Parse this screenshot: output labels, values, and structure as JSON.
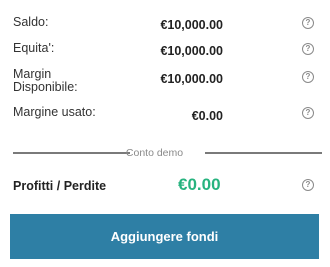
{
  "account": {
    "rows": [
      {
        "label": "Saldo:",
        "value": "€10,000.00"
      },
      {
        "label": "Equita':",
        "value": "€10,000.00"
      },
      {
        "label": "Margin\nDisponibile:",
        "value": "€10,000.00"
      },
      {
        "label": "Margine usato:",
        "value": "€0.00"
      }
    ],
    "help_icon": "?"
  },
  "divider": {
    "label": "Conto demo"
  },
  "profit_loss": {
    "label": "Profitti / Perdite",
    "value": "€0.00",
    "value_color": "#27b37f"
  },
  "actions": {
    "add_funds_label": "Aggiungere fondi",
    "button_color": "#2e7fa5"
  },
  "icons": {
    "help": "question-circle-icon"
  }
}
